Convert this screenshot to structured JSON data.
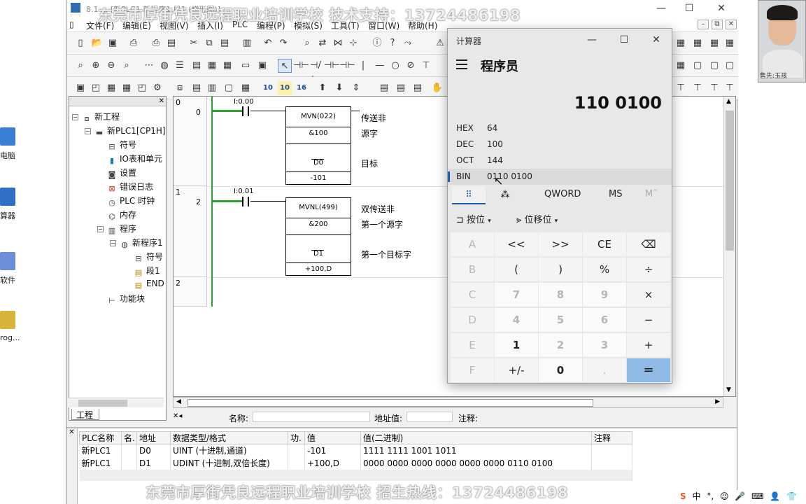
{
  "desktop": {
    "icons": [
      {
        "label": "电脑",
        "color": "#3b7ed6"
      },
      {
        "label": "算器",
        "color": "#2d6fc4"
      },
      {
        "label": "软件",
        "color": "#6a8fd8"
      },
      {
        "label": "rog...",
        "color": "#d8b33a"
      }
    ]
  },
  "webcam": {
    "caption": "售先:玉孩"
  },
  "app": {
    "title": "8.1 ... [新PLC1.新程序1.段1 (梯形图)]",
    "menu": [
      "文件(F)",
      "编辑(E)",
      "视图(V)",
      "插入(I)",
      "PLC",
      "编程(P)",
      "模拟(S)",
      "工具(T)",
      "窗口(W)",
      "帮助(H)"
    ],
    "toolbar_text_icons": [
      "10",
      "10",
      "16"
    ]
  },
  "tree": {
    "tab": "工程",
    "items": [
      {
        "label": "新工程",
        "icon": "network-icon"
      },
      {
        "label": "新PLC1[CP1H]",
        "icon": "plc-icon"
      },
      {
        "label": "符号",
        "icon": "symbol-icon"
      },
      {
        "label": "IO表和单元",
        "icon": "io-table-icon"
      },
      {
        "label": "设置",
        "icon": "settings-icon"
      },
      {
        "label": "错误日志",
        "icon": "error-log-icon"
      },
      {
        "label": "PLC 时钟",
        "icon": "clock-icon"
      },
      {
        "label": "内存",
        "icon": "memory-icon"
      },
      {
        "label": "程序",
        "icon": "programs-icon"
      },
      {
        "label": "新程序1",
        "icon": "program-icon"
      },
      {
        "label": "符号",
        "icon": "symbol-icon"
      },
      {
        "label": "段1",
        "icon": "section-icon"
      },
      {
        "label": "END",
        "icon": "end-section-icon"
      },
      {
        "label": "功能块",
        "icon": "function-block-icon"
      }
    ]
  },
  "ladder": {
    "rungs": [
      {
        "rung_no": "0",
        "step_no": "0",
        "contact": "I:0.00",
        "instr": "MVN(022)",
        "op1": "&100",
        "op2": "D0",
        "value": "-101",
        "comments": [
          "传送非",
          "源字",
          "目标"
        ]
      },
      {
        "rung_no": "1",
        "step_no": "2",
        "contact": "I:0.01",
        "instr": "MVNL(499)",
        "op1": "&200",
        "op2": "D1",
        "value": "+100,D",
        "comments": [
          "双传送非",
          "第一个源字",
          "第一个目标字"
        ]
      },
      {
        "rung_no": "2",
        "step_no": ""
      }
    ]
  },
  "status_bar": {
    "name_label": "名称:",
    "address_label": "地址值:",
    "comment_label": "注释:"
  },
  "watch": {
    "columns": [
      "PLC名称",
      "名.",
      "地址",
      "数据类型/格式",
      "功.",
      "值",
      "值(二进制)",
      "注释"
    ],
    "rows": [
      [
        "新PLC1",
        "",
        "D0",
        "UINT (十进制,通道)",
        "",
        "-101",
        "1111 1111 1001 1011",
        ""
      ],
      [
        "新PLC1",
        "",
        "D1",
        "UDINT (十进制,双倍长度)",
        "",
        "+100,D",
        "0000 0000 0000 0000 0000 0000 0110 0100",
        ""
      ]
    ]
  },
  "calculator": {
    "window_title": "计算器",
    "mode": "程序员",
    "display": "110 0100",
    "radix": [
      {
        "label": "HEX",
        "value": "64"
      },
      {
        "label": "DEC",
        "value": "100"
      },
      {
        "label": "OCT",
        "value": "144"
      },
      {
        "label": "BIN",
        "value": "0110 0100"
      }
    ],
    "word_size": "QWORD",
    "ms": "MS",
    "mplus": "M˜",
    "bitwise": "按位",
    "bitshift": "位移位",
    "keys": [
      [
        "A",
        "<<",
        ">>",
        "CE",
        "⌫"
      ],
      [
        "B",
        "(",
        ")",
        "%",
        "÷"
      ],
      [
        "C",
        "7",
        "8",
        "9",
        "×"
      ],
      [
        "D",
        "4",
        "5",
        "6",
        "−"
      ],
      [
        "E",
        "1",
        "2",
        "3",
        "+"
      ],
      [
        "F",
        "+/-",
        "0",
        ".",
        "="
      ]
    ]
  },
  "overlays": {
    "top": "东莞市厚街凭良远程职业培训学校  技术支持：13724486198",
    "bottom": "东莞市厚街凭良远程职业培训学校  招生热线：13724486198"
  },
  "tray": {
    "ime": "中",
    "punct": "°,"
  }
}
